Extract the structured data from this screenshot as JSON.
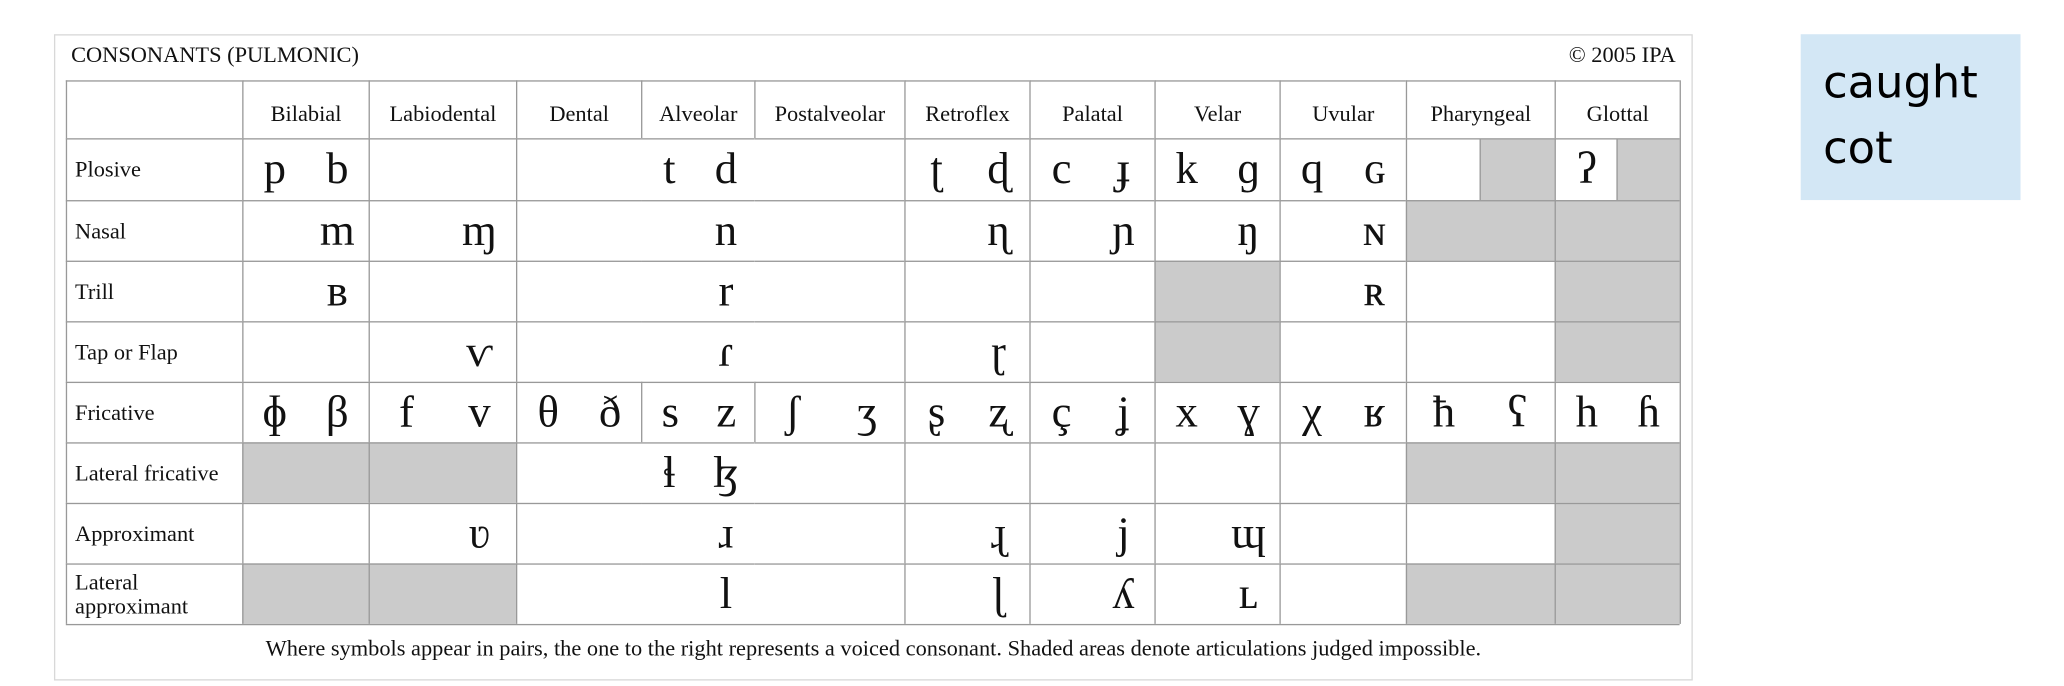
{
  "chart": {
    "title": "CONSONANTS (PULMONIC)",
    "copyright": "© 2005 IPA",
    "columns": [
      "Bilabial",
      "Labiodental",
      "Dental",
      "Alveolar",
      "Postalveolar",
      "Retroflex",
      "Palatal",
      "Velar",
      "Uvular",
      "Pharyngeal",
      "Glottal"
    ],
    "rows": [
      {
        "label": "Plosive",
        "cells": [
          [
            "p",
            "b"
          ],
          [
            "",
            ""
          ],
          [
            "",
            ""
          ],
          [
            "t",
            "d"
          ],
          [
            "",
            ""
          ],
          [
            "ʈ",
            "ɖ"
          ],
          [
            "c",
            "ɟ"
          ],
          [
            "k",
            "ɡ"
          ],
          [
            "q",
            "ɢ"
          ],
          [
            "",
            ""
          ],
          [
            "ʔ",
            ""
          ]
        ],
        "shade": {
          "9": "right",
          "10": "right"
        }
      },
      {
        "label": "Nasal",
        "cells": [
          [
            "",
            "m"
          ],
          [
            "",
            "ɱ"
          ],
          [
            "",
            ""
          ],
          [
            "",
            "n"
          ],
          [
            "",
            ""
          ],
          [
            "",
            "ɳ"
          ],
          [
            "",
            "ɲ"
          ],
          [
            "",
            "ŋ"
          ],
          [
            "",
            "ɴ"
          ],
          [
            "",
            ""
          ],
          [
            "",
            ""
          ]
        ],
        "shade": {
          "9": "full",
          "10": "full"
        }
      },
      {
        "label": "Trill",
        "cells": [
          [
            "",
            "ʙ"
          ],
          [
            "",
            ""
          ],
          [
            "",
            ""
          ],
          [
            "",
            "r"
          ],
          [
            "",
            ""
          ],
          [
            "",
            ""
          ],
          [
            "",
            ""
          ],
          [
            "",
            ""
          ],
          [
            "",
            "ʀ"
          ],
          [
            "",
            ""
          ],
          [
            "",
            ""
          ]
        ],
        "shade": {
          "7": "full",
          "10": "full"
        }
      },
      {
        "label": "Tap or Flap",
        "cells": [
          [
            "",
            ""
          ],
          [
            "",
            "ⱱ"
          ],
          [
            "",
            ""
          ],
          [
            "",
            "ɾ"
          ],
          [
            "",
            ""
          ],
          [
            "",
            "ɽ"
          ],
          [
            "",
            ""
          ],
          [
            "",
            ""
          ],
          [
            "",
            ""
          ],
          [
            "",
            ""
          ],
          [
            "",
            ""
          ]
        ],
        "shade": {
          "7": "full",
          "10": "full"
        }
      },
      {
        "label": "Fricative",
        "cells": [
          [
            "ɸ",
            "β"
          ],
          [
            "f",
            "v"
          ],
          [
            "θ",
            "ð"
          ],
          [
            "s",
            "z"
          ],
          [
            "ʃ",
            "ʒ"
          ],
          [
            "ʂ",
            "ʐ"
          ],
          [
            "ç",
            "ʝ"
          ],
          [
            "x",
            "ɣ"
          ],
          [
            "χ",
            "ʁ"
          ],
          [
            "ħ",
            "ʕ"
          ],
          [
            "h",
            "ɦ"
          ]
        ],
        "shade": {}
      },
      {
        "label": "Lateral fricative",
        "cells": [
          [
            "",
            ""
          ],
          [
            "",
            ""
          ],
          [
            "",
            ""
          ],
          [
            "ɬ",
            "ɮ"
          ],
          [
            "",
            ""
          ],
          [
            "",
            ""
          ],
          [
            "",
            ""
          ],
          [
            "",
            ""
          ],
          [
            "",
            ""
          ],
          [
            "",
            ""
          ],
          [
            "",
            ""
          ]
        ],
        "shade": {
          "0": "full",
          "1": "full",
          "9": "full",
          "10": "full"
        }
      },
      {
        "label": "Approximant",
        "cells": [
          [
            "",
            ""
          ],
          [
            "",
            "ʋ"
          ],
          [
            "",
            ""
          ],
          [
            "",
            "ɹ"
          ],
          [
            "",
            ""
          ],
          [
            "",
            "ɻ"
          ],
          [
            "",
            "j"
          ],
          [
            "",
            "ɰ"
          ],
          [
            "",
            ""
          ],
          [
            "",
            ""
          ],
          [
            "",
            ""
          ]
        ],
        "shade": {
          "10": "full"
        }
      },
      {
        "label": "Lateral approximant",
        "cells": [
          [
            "",
            ""
          ],
          [
            "",
            ""
          ],
          [
            "",
            ""
          ],
          [
            "",
            "l"
          ],
          [
            "",
            ""
          ],
          [
            "",
            "ɭ"
          ],
          [
            "",
            "ʎ"
          ],
          [
            "",
            "ʟ"
          ],
          [
            "",
            ""
          ],
          [
            "",
            ""
          ],
          [
            "",
            ""
          ]
        ],
        "shade": {
          "0": "full",
          "1": "full",
          "9": "full",
          "10": "full"
        }
      }
    ],
    "footer": "Where symbols appear in pairs, the one to the right represents a voiced consonant. Shaded areas denote articulations judged impossible.",
    "shade_color": "#cbcbcb"
  },
  "side_box": {
    "line1": "caught",
    "line2": "cot",
    "background": "#d3e7f5"
  }
}
